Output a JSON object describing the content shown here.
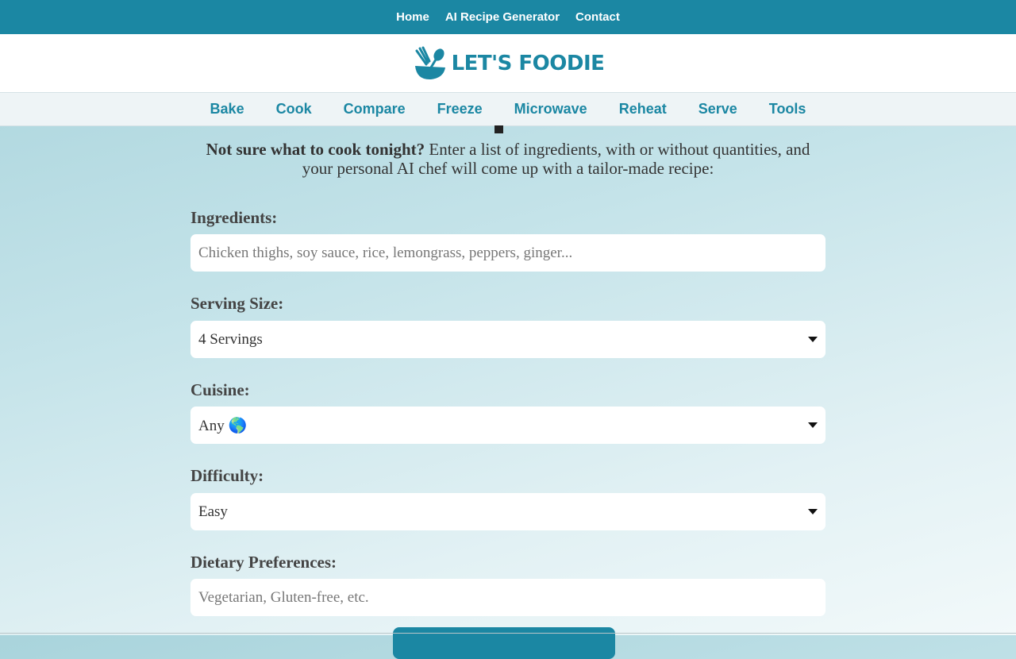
{
  "top_nav": {
    "items": [
      "Home",
      "AI Recipe Generator",
      "Contact"
    ]
  },
  "brand": {
    "name": "LET'S FOODIE"
  },
  "category_nav": {
    "items": [
      "Bake",
      "Cook",
      "Compare",
      "Freeze",
      "Microwave",
      "Reheat",
      "Serve",
      "Tools"
    ]
  },
  "intro": {
    "question": "Not sure what to cook tonight?",
    "text": " Enter a list of ingredients, with or without quantities, and your personal AI chef will come up with a tailor-made recipe:"
  },
  "form": {
    "ingredients": {
      "label": "Ingredients:",
      "placeholder": "Chicken thighs, soy sauce, rice, lemongrass, peppers, ginger...",
      "value": ""
    },
    "serving_size": {
      "label": "Serving Size:",
      "selected": "4 Servings"
    },
    "cuisine": {
      "label": "Cuisine:",
      "selected": "Any 🌎"
    },
    "difficulty": {
      "label": "Difficulty:",
      "selected": "Easy"
    },
    "dietary": {
      "label": "Dietary Preferences:",
      "placeholder": "Vegetarian, Gluten-free, etc.",
      "value": ""
    }
  },
  "colors": {
    "brand": "#1b87a3",
    "text": "#333333"
  }
}
